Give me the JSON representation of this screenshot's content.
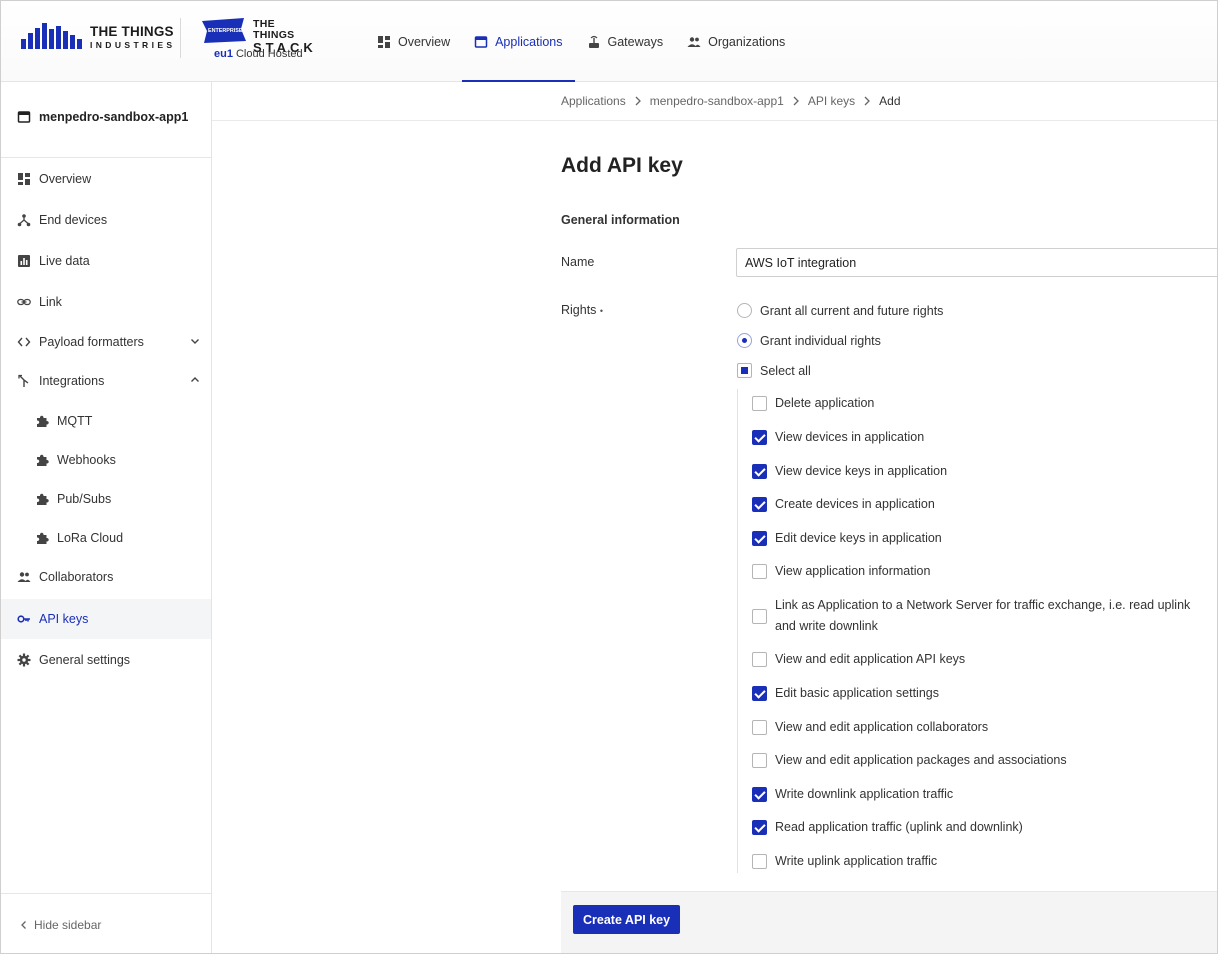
{
  "brand": {
    "tti_line1": "THE THINGS",
    "tti_line2": "INDUSTRIES",
    "stack_line1": "THE THINGS",
    "stack_line2": "STACK",
    "enterprise": "ENTERPRISE",
    "cluster": "eu1",
    "hosting": "Cloud Hosted",
    "accent": "#1a2fb8"
  },
  "topnav": [
    {
      "label": "Overview",
      "icon": "dashboard-icon",
      "active": false
    },
    {
      "label": "Applications",
      "icon": "window-icon",
      "active": true
    },
    {
      "label": "Gateways",
      "icon": "gateway-icon",
      "active": false
    },
    {
      "label": "Organizations",
      "icon": "people-icon",
      "active": false
    }
  ],
  "sidebar": {
    "app_name": "menpedro-sandbox-app1",
    "items": [
      {
        "label": "Overview",
        "icon": "dashboard-icon"
      },
      {
        "label": "End devices",
        "icon": "devices-icon"
      },
      {
        "label": "Live data",
        "icon": "chart-icon"
      },
      {
        "label": "Link",
        "icon": "link-icon"
      },
      {
        "label": "Payload formatters",
        "icon": "code-icon"
      },
      {
        "label": "Integrations",
        "icon": "merge-icon"
      },
      {
        "label": "MQTT",
        "icon": "puzzle-icon"
      },
      {
        "label": "Webhooks",
        "icon": "puzzle-icon"
      },
      {
        "label": "Pub/Subs",
        "icon": "puzzle-icon"
      },
      {
        "label": "LoRa Cloud",
        "icon": "puzzle-icon"
      },
      {
        "label": "Collaborators",
        "icon": "people-icon"
      },
      {
        "label": "API keys",
        "icon": "key-icon",
        "active": true
      },
      {
        "label": "General settings",
        "icon": "gear-icon"
      }
    ],
    "hide_label": "Hide sidebar"
  },
  "breadcrumb": [
    "Applications",
    "menpedro-sandbox-app1",
    "API keys",
    "Add"
  ],
  "form": {
    "title": "Add API key",
    "section": "General information",
    "name_label": "Name",
    "name_value": "AWS IoT integration",
    "rights_label": "Rights",
    "required_mark": "•",
    "grant_all": "Grant all current and future rights",
    "grant_individual": "Grant individual rights",
    "select_all": "Select all",
    "rights": [
      {
        "label": "Delete application",
        "checked": false
      },
      {
        "label": "View devices in application",
        "checked": true
      },
      {
        "label": "View device keys in application",
        "checked": true
      },
      {
        "label": "Create devices in application",
        "checked": true
      },
      {
        "label": "Edit device keys in application",
        "checked": true
      },
      {
        "label": "View application information",
        "checked": false
      },
      {
        "label": "Link as Application to a Network Server for traffic exchange, i.e. read uplink and write downlink",
        "checked": false
      },
      {
        "label": "View and edit application API keys",
        "checked": false
      },
      {
        "label": "Edit basic application settings",
        "checked": true
      },
      {
        "label": "View and edit application collaborators",
        "checked": false
      },
      {
        "label": "View and edit application packages and associations",
        "checked": false
      },
      {
        "label": "Write downlink application traffic",
        "checked": true
      },
      {
        "label": "Read application traffic (uplink and downlink)",
        "checked": true
      },
      {
        "label": "Write uplink application traffic",
        "checked": false
      }
    ],
    "submit_label": "Create API key"
  }
}
